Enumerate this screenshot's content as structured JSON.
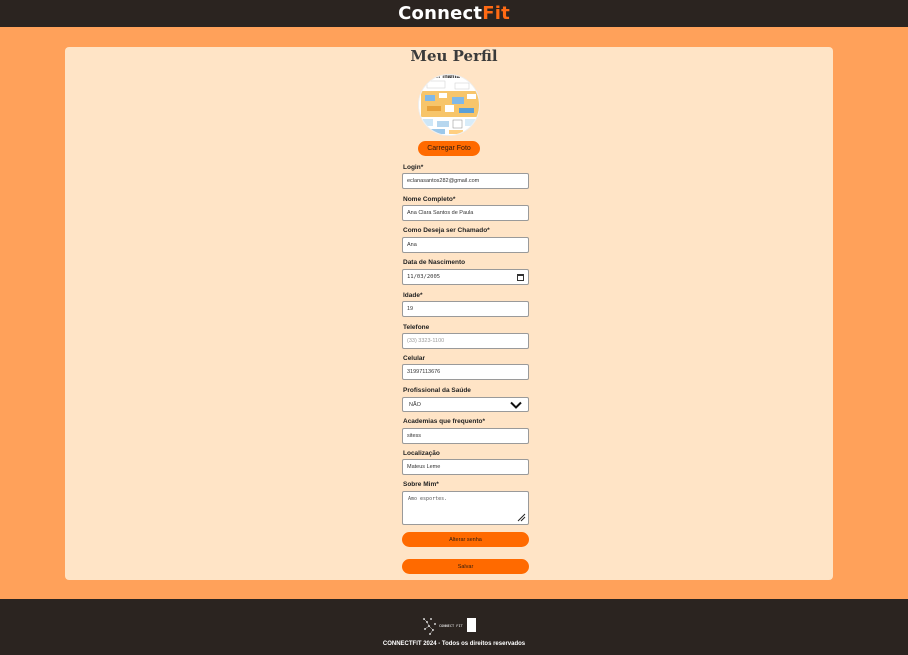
{
  "header": {
    "brand_part1": "Connect",
    "brand_part2": "Fit"
  },
  "page": {
    "title": "Meu Perfil"
  },
  "profile": {
    "upload_label": "Carregar Foto",
    "avatar_caption": "er mama"
  },
  "form": {
    "login": {
      "label": "Login*",
      "value": "eclanasantos282@gmail.com"
    },
    "full_name": {
      "label": "Nome Completo*",
      "value": "Ana Clara Santos de Paula"
    },
    "nickname": {
      "label": "Como Deseja ser Chamado*",
      "value": "Ana"
    },
    "birth_date": {
      "label": "Data de Nascimento",
      "value": "11/03/2005"
    },
    "age": {
      "label": "Idade*",
      "value": "19"
    },
    "phone": {
      "label": "Telefone",
      "placeholder": "(33) 3323-1100"
    },
    "mobile": {
      "label": "Celular",
      "value": "31997113676"
    },
    "health_pro": {
      "label": "Profissional da Saúde",
      "selected": "NÃO"
    },
    "gyms": {
      "label": "Academias que frequento*",
      "value": "sitess"
    },
    "location": {
      "label": "Localização",
      "value": "Mateus Leme"
    },
    "about": {
      "label": "Sobre Mim*",
      "value": "Amo esportes."
    }
  },
  "actions": {
    "change_password": "Alterar senha",
    "save": "Salvar"
  },
  "footer": {
    "logo_text": "CONNECT FIT",
    "copyright": "CONNECTFIT 2024 - Todos os direitos reservados"
  },
  "colors": {
    "accent": "#ff6a00",
    "page_bg": "#ffa15a",
    "card_bg": "#ffe4c6",
    "bar_bg": "#2b2420"
  }
}
